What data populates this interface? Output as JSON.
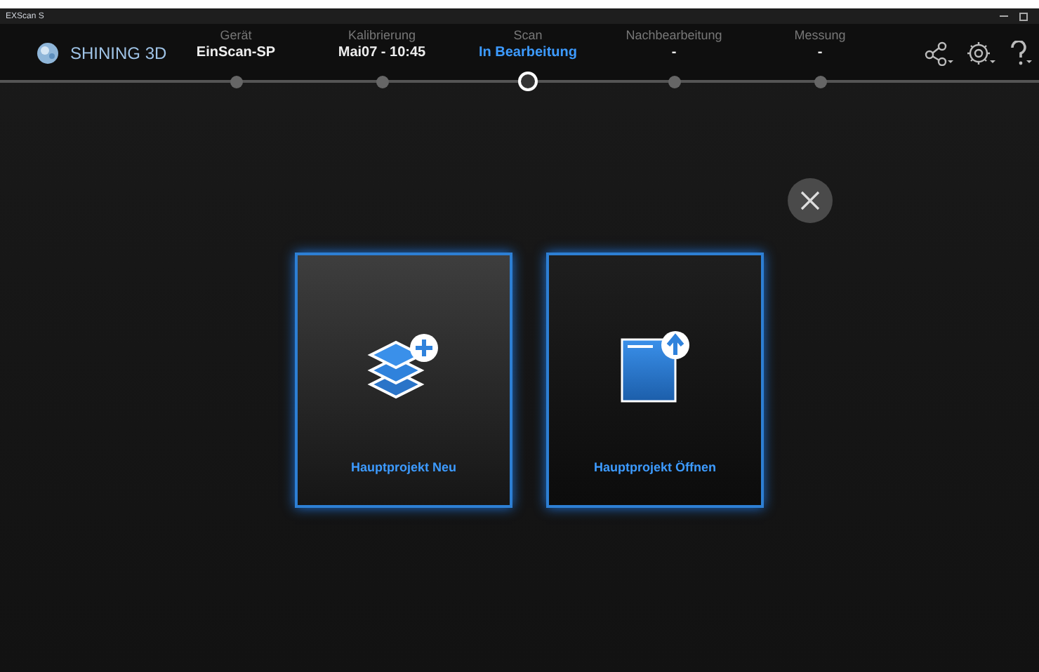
{
  "window": {
    "title": "EXScan S"
  },
  "logo": {
    "text": "SHINING 3D"
  },
  "steps": [
    {
      "label": "Gerät",
      "value": "EinScan-SP",
      "selected": false
    },
    {
      "label": "Kalibrierung",
      "value": "Mai07 - 10:45",
      "selected": false
    },
    {
      "label": "Scan",
      "value": "In Bearbeitung",
      "selected": true
    },
    {
      "label": "Nachbearbeitung",
      "value": "-",
      "selected": false
    },
    {
      "label": "Messung",
      "value": "-",
      "selected": false
    }
  ],
  "actions": [
    {
      "kind": "new",
      "label": "Hauptprojekt Neu"
    },
    {
      "kind": "open",
      "label": "Hauptprojekt Öffnen"
    }
  ]
}
